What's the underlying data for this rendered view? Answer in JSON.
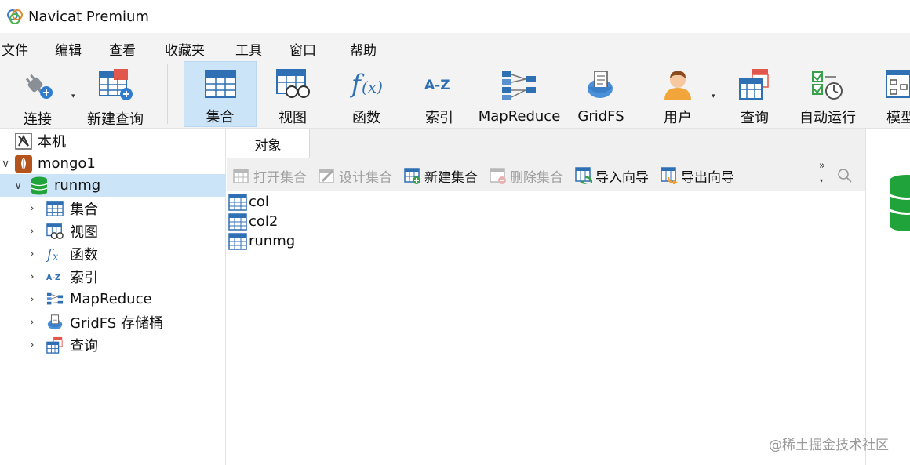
{
  "window": {
    "title": "Navicat Premium"
  },
  "menubar": {
    "items": [
      "文件",
      "编辑",
      "查看",
      "收藏夹",
      "工具",
      "窗口",
      "帮助"
    ]
  },
  "toolbar": {
    "buttons": [
      {
        "label": "连接",
        "icon": "plug-icon",
        "has_dropdown": true
      },
      {
        "label": "新建查询",
        "icon": "new-query-icon"
      },
      {
        "label": "集合",
        "icon": "collection-icon",
        "active": true
      },
      {
        "label": "视图",
        "icon": "view-icon"
      },
      {
        "label": "函数",
        "icon": "function-icon"
      },
      {
        "label": "索引",
        "icon": "index-icon"
      },
      {
        "label": "MapReduce",
        "icon": "mapreduce-icon"
      },
      {
        "label": "GridFS",
        "icon": "gridfs-icon"
      },
      {
        "label": "用户",
        "icon": "user-icon",
        "has_dropdown": true
      },
      {
        "label": "查询",
        "icon": "query-icon"
      },
      {
        "label": "自动运行",
        "icon": "autorun-icon"
      },
      {
        "label": "模型",
        "icon": "model-icon"
      }
    ]
  },
  "tree": {
    "items": [
      {
        "label": "本机",
        "icon": "local-icon",
        "level": 0
      },
      {
        "label": "mongo1",
        "icon": "mongodb-leaf-icon",
        "level": 0,
        "expanded": true
      },
      {
        "label": "runmg",
        "icon": "database-icon",
        "level": 1,
        "expanded": true,
        "selected": true
      },
      {
        "label": "集合",
        "icon": "collection-icon",
        "level": 2
      },
      {
        "label": "视图",
        "icon": "view-icon",
        "level": 2
      },
      {
        "label": "函数",
        "icon": "function-icon",
        "level": 2
      },
      {
        "label": "索引",
        "icon": "index-icon",
        "level": 2
      },
      {
        "label": "MapReduce",
        "icon": "mapreduce-icon",
        "level": 2
      },
      {
        "label": "GridFS 存储桶",
        "icon": "gridfs-icon",
        "level": 2
      },
      {
        "label": "查询",
        "icon": "query-icon",
        "level": 2
      }
    ]
  },
  "main": {
    "tab_label": "对象",
    "object_toolbar": [
      {
        "label": "打开集合",
        "icon": "open-collection-icon",
        "enabled": false
      },
      {
        "label": "设计集合",
        "icon": "design-collection-icon",
        "enabled": false
      },
      {
        "label": "新建集合",
        "icon": "new-collection-icon",
        "enabled": true
      },
      {
        "label": "删除集合",
        "icon": "delete-collection-icon",
        "enabled": false
      },
      {
        "label": "导入向导",
        "icon": "import-wizard-icon",
        "enabled": true
      },
      {
        "label": "导出向导",
        "icon": "export-wizard-icon",
        "enabled": true
      }
    ],
    "more_glyph": "»",
    "objects": [
      "col",
      "col2",
      "runmg"
    ]
  },
  "watermark": "@稀土掘金技术社区",
  "colors": {
    "accent_selection": "#cce4f7",
    "toolbar_bg": "#f3f3f3",
    "db_green": "#1fa33a",
    "icon_blue": "#2f6fb4"
  }
}
